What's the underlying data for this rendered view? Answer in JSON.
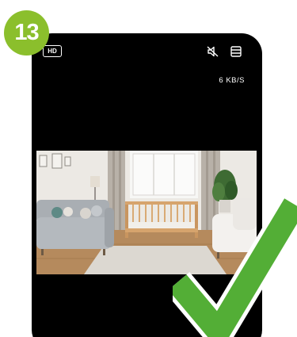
{
  "step": {
    "number": "13",
    "color": "#8bbf2c"
  },
  "camera": {
    "quality_badge": "HD",
    "speed": "6 KB/S",
    "icons": {
      "mute": "speaker-muted-icon",
      "layout": "layout-icon"
    },
    "feed_scene": "nursery-room-feed"
  },
  "overlay": {
    "icon": "checkmark-icon",
    "color": "#53ae36"
  }
}
